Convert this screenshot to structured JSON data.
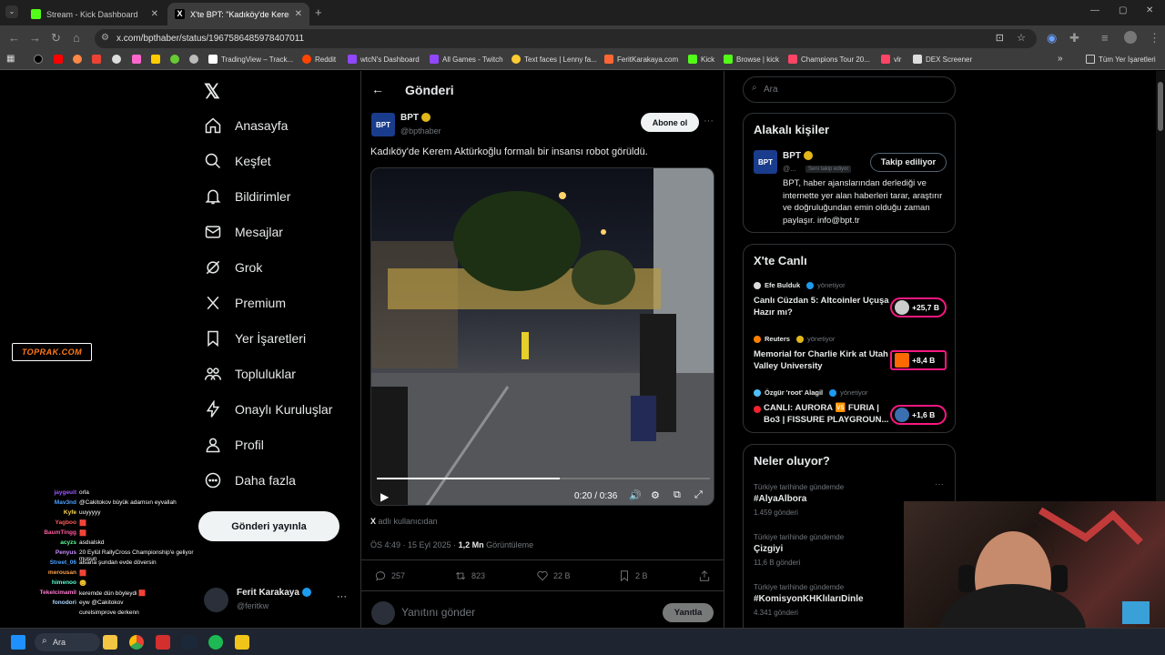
{
  "browser": {
    "tabs": [
      {
        "title": "Stream - Kick Dashboard",
        "active": false
      },
      {
        "title": "X'te BPT: \"Kadıköy'de Kerem Ak",
        "active": true
      }
    ],
    "new_tab": "+",
    "url": "x.com/bpthaber/status/1967586485978407011",
    "bookmarks": [
      "TradingView – Track...",
      "Reddit",
      "wtcN's Dashboard",
      "All Games - Twitch",
      "Text faces | Lenny fa...",
      "FeritKarakaya.com",
      "Kick",
      "Browse | kick",
      "Champions Tour 20...",
      "vlr",
      "DEX Screener"
    ],
    "all_bookmarks": "Tüm Yer İşaretleri"
  },
  "sidebar": {
    "logo": "𝕏",
    "items": [
      "Anasayfa",
      "Keşfet",
      "Bildirimler",
      "Mesajlar",
      "Grok",
      "Premium",
      "Yer İşaretleri",
      "Topluluklar",
      "Onaylı Kuruluşlar",
      "Profil",
      "Daha fazla"
    ],
    "post_button": "Gönderi yayınla",
    "user": {
      "name": "Ferit Karakaya",
      "handle": "@feritkw",
      "more": "···"
    }
  },
  "post": {
    "header": "Gönderi",
    "author": {
      "name": "BPT",
      "handle": "@bpthaber",
      "avatar_text": "BPT"
    },
    "subscribe": "Abone ol",
    "more": "···",
    "text": "Kadıköy'de Kerem Aktürkoğlu formalı bir insansı robot görüldü.",
    "video": {
      "time": "0:20 / 0:36",
      "progress": 0.55
    },
    "source": "adlı kullanıcıdan",
    "timestamp": "ÖS 4:49 · 15 Eyl 2025 · ",
    "views_count": "1,2 Mn",
    "views_label": "Görüntüleme",
    "actions": {
      "replies": "257",
      "reposts": "823",
      "likes": "22 B",
      "bookmarks": "2 B"
    },
    "reply_placeholder": "Yanıtını gönder",
    "reply_button": "Yanıtla"
  },
  "search": {
    "placeholder": "Ara"
  },
  "relevant": {
    "title": "Alakalı kişiler",
    "name": "BPT",
    "handle": "@...",
    "follows_you": "Seni takip ediyor",
    "button": "Takip ediliyor",
    "bio": "BPT, haber ajanslarından derlediği ve internette yer alan haberleri tarar, araştırır ve doğruluğundan emin olduğu zaman paylaşır. info@bpt.tr"
  },
  "live": {
    "title": "X'te Canlı",
    "items": [
      {
        "host": "Efe Bulduk",
        "role": "yönetiyor",
        "title": "Canlı Cüzdan 5: Altcoinler Uçuşa Hazır mı?",
        "count": "+25,7 B"
      },
      {
        "host": "Reuters",
        "role": "yönetiyor",
        "title": "Memorial for Charlie Kirk at Utah Valley University",
        "count": "+8,4 B"
      },
      {
        "host": "Özgür 'root' Alagil",
        "role": "yönetiyor",
        "title": "CANLI: AURORA 🆚 FURIA | Bo3 | FISSURE PLAYGROUN...",
        "count": "+1,6 B"
      }
    ]
  },
  "trends": {
    "title": "Neler oluyor?",
    "items": [
      {
        "category": "Türkiye tarihinde gündemde",
        "name": "#AlyaAlbora",
        "count": "1.459 gönderi"
      },
      {
        "category": "Türkiye tarihinde gündemde",
        "name": "Çizgiyi",
        "count": "11,6 B gönderi"
      },
      {
        "category": "Türkiye tarihinde gündemde",
        "name": "#KomisyonKHKlılarıDinle",
        "count": "4.341 gönderi"
      }
    ]
  },
  "overlay_logo": "TOPRAK.COM",
  "chat": [
    {
      "user": "jaygeuit",
      "msg": "orla",
      "color": "#9b59ff"
    },
    {
      "user": "Mav3nd",
      "msg": "@Cakitokov büyük adamsın eyvallah",
      "color": "#4aa3ff"
    },
    {
      "user": "Kyfe",
      "msg": "uuyyyyy",
      "color": "#ffd84a"
    },
    {
      "user": "Yagboo",
      "msg": "🟥",
      "color": "#ff5a5a"
    },
    {
      "user": "BaumTingg",
      "msg": "🟥",
      "color": "#ff5aa0"
    },
    {
      "user": "acyzs",
      "msg": "asdıalskd",
      "color": "#5aff9a"
    },
    {
      "user": "Penyus",
      "msg": "20 Eylül RallyCross Championship'e geliyor musun",
      "color": "#c78cff"
    },
    {
      "user": "Street_06",
      "msg": "alsana şundan evde döversin",
      "color": "#4aa3ff"
    },
    {
      "user": "merousan",
      "msg": "🟥",
      "color": "#ffa04a"
    },
    {
      "user": "himenoo",
      "msg": "😊",
      "color": "#5affd1"
    },
    {
      "user": "Tekelcimamil",
      "msg": "keremde dün böyleydi 🟥",
      "color": "#ff7ad0"
    },
    {
      "user": "fonodori",
      "msg": "eyw @Cakitokov",
      "color": "#aad4ff"
    },
    {
      "user": "",
      "msg": "curelsimprove derkenn",
      "color": "#aaaaaa"
    }
  ],
  "taskbar": {
    "search": "Ara"
  }
}
